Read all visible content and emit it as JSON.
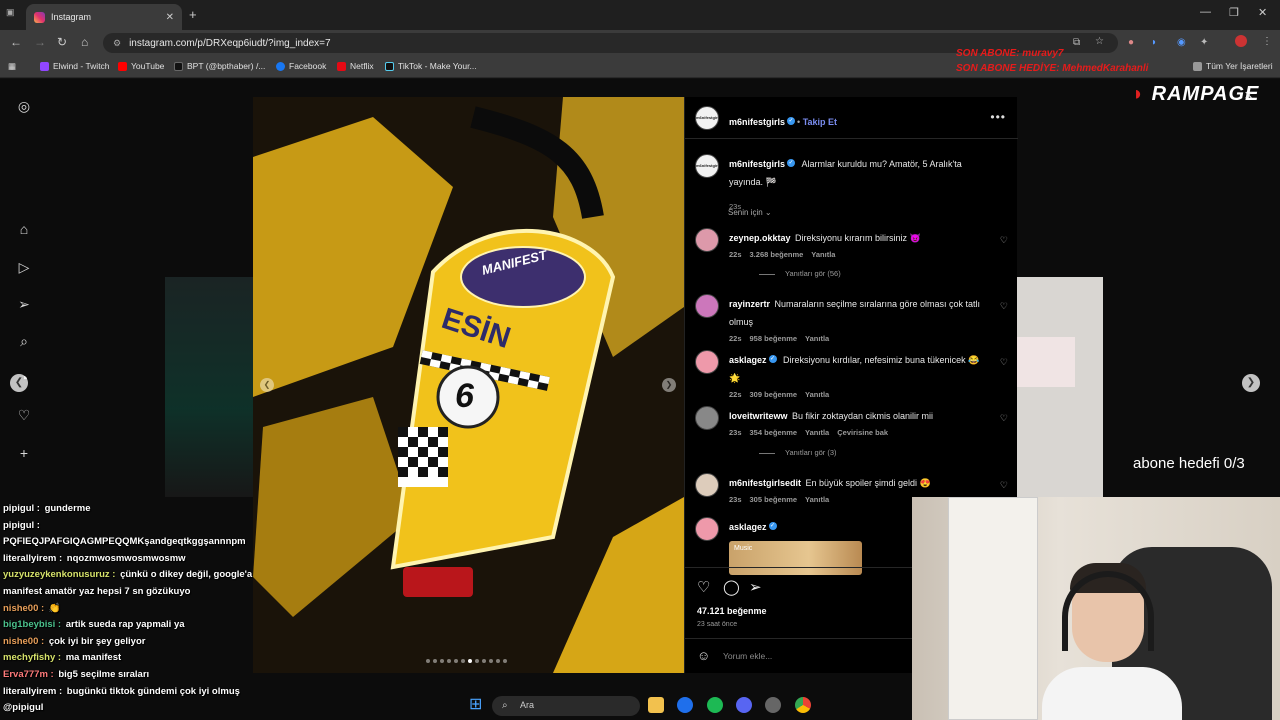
{
  "browser": {
    "tab_title": "Instagram",
    "url": "instagram.com/p/DRXeqp6iudt/?img_index=7",
    "bookmarks": [
      "Elwind - Twitch",
      "YouTube",
      "BPT (@bpthaber) /...",
      "Facebook",
      "Netflix",
      "TikTok - Make Your...",
      "Tüm Yer İşaretleri"
    ],
    "colors": {
      "twitch": "#9146ff",
      "youtube": "#ff0000",
      "facebook": "#1877f2",
      "netflix": "#e50914",
      "tiktok": "#111111"
    }
  },
  "post": {
    "author": "m6nifestgirls",
    "follow_label": "Takip Et",
    "caption": "Alarmlar kuruldu mu? Amatör, 5 Aralık'ta yayında. 🏁",
    "caption_time": "23s",
    "sort_label": "Senin için",
    "likes": "47.121 beğenme",
    "posted": "23 saat önce",
    "comment_placeholder": "Yorum ekle...",
    "music_label": "Music",
    "comments": [
      {
        "user": "zeynep.okktay",
        "verified": false,
        "text": "Direksiyonu kırarım bilirsiniz 😈",
        "time": "22s",
        "likes": "3.268 beğenme",
        "reply": "Yanıtla",
        "more_replies": "Yanıtları gör (56)"
      },
      {
        "user": "rayinzertr",
        "verified": false,
        "text": "Numaraların seçilme sıralarına göre olması çok tatlı olmuş",
        "time": "22s",
        "likes": "958 beğenme",
        "reply": "Yanıtla"
      },
      {
        "user": "asklagez",
        "verified": true,
        "text": "Direksiyonu kırdılar, nefesimiz buna tükenicek 😂 🌟",
        "time": "22s",
        "likes": "309 beğenme",
        "reply": "Yanıtla"
      },
      {
        "user": "loveitwriteww",
        "verified": false,
        "text": "Bu fikir zoktaydan cikmis olanilir mii",
        "time": "23s",
        "likes": "354 beğenme",
        "reply": "Yanıtla",
        "translate": "Çevirisine bak",
        "more_replies": "Yanıtları gör (3)"
      },
      {
        "user": "m6nifestgirlsedit",
        "verified": false,
        "text": "En büyük spoiler şimdi geldi 😍",
        "time": "23s",
        "likes": "305 beğenme",
        "reply": "Yanıtla"
      },
      {
        "user": "asklagez",
        "verified": true,
        "text": "",
        "time": "",
        "likes": "",
        "reply": ""
      }
    ],
    "kart": {
      "brand": "MANIFEST",
      "name": "ESİN",
      "number": "6"
    },
    "carousel_dots": 12,
    "carousel_active": 6
  },
  "overlay": {
    "brand": "RAMPAGE",
    "goal": "abone hedefi 0/3",
    "last_sub": "SON ABONE: muravy7",
    "last_gift": "SON ABONE HEDİYE: MehmedKarahanli"
  },
  "chat": [
    {
      "user": "pipigul",
      "msg": "gunderme",
      "color": "#ffffff"
    },
    {
      "user": "pipigul",
      "msg": "",
      "color": "#ffffff"
    },
    {
      "user": "",
      "msg": "PQFIEQJPAFGIQAGMPEQQMKşandgeqtkggşannnpm",
      "color": "#ffffff"
    },
    {
      "user": "literallyirem",
      "msg": "nqozmwosmwosmwosmw",
      "color": "#ffffff"
    },
    {
      "user": "yuzyuzeykenkonusuruz",
      "msg": "çünkü o dikey değil, google'a",
      "color": "#d7e36b"
    },
    {
      "user": "",
      "msg": "manifest amatör yaz hepsi 7 sn gözükuyo",
      "color": "#ffffff"
    },
    {
      "user": "nishe00",
      "msg": "👏",
      "color": "#e89f5a"
    },
    {
      "user": "big1beybisi",
      "msg": "artik sueda rap yapmali ya",
      "color": "#4cc28d"
    },
    {
      "user": "nishe00",
      "msg": "çok iyi bir şey geliyor",
      "color": "#e89f5a"
    },
    {
      "user": "mechyfishy",
      "msg": "ma manifest",
      "color": "#d7e36b"
    },
    {
      "user": "Erva777m",
      "msg": "big5 seçilme sıraları",
      "color": "#ff7b7b"
    },
    {
      "user": "literallyirem",
      "msg": "bugünkü tiktok gündemi çok iyi olmuş",
      "color": "#ffffff"
    },
    {
      "user": "",
      "msg": "@pipigul",
      "color": "#ffffff"
    }
  ],
  "taskbar": {
    "search": "Ara"
  }
}
